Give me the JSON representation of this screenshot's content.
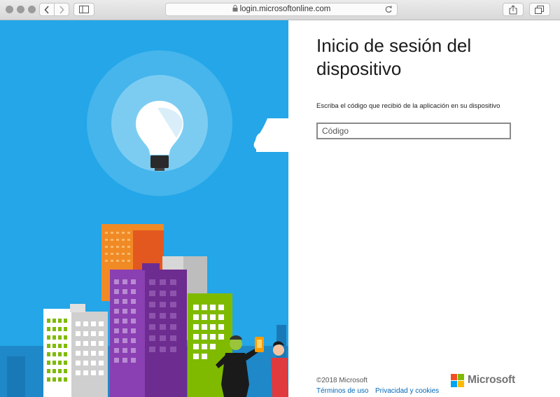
{
  "browser": {
    "url": "login.microsoftonline.com",
    "icons": {
      "back": "chevron-left-icon",
      "forward": "chevron-right-icon",
      "sidebar": "sidebar-icon",
      "lock": "lock-icon",
      "reload": "reload-icon",
      "share": "share-icon",
      "tabs": "tabs-icon"
    }
  },
  "signin": {
    "title": "Inicio de sesión del dispositivo",
    "subtitle": "Escriba el código que recibió de la aplicación en su dispositivo",
    "code_placeholder": "Código",
    "code_value": ""
  },
  "footer": {
    "copyright": "©2018 Microsoft",
    "terms": "Términos de uso",
    "privacy": "Privacidad y cookies",
    "brand": "Microsoft"
  },
  "colors": {
    "sky": "#24a6e8",
    "link": "#0067b8",
    "ms_red": "#f25022",
    "ms_green": "#7fba00",
    "ms_blue": "#00a4ef",
    "ms_yellow": "#ffb900"
  }
}
